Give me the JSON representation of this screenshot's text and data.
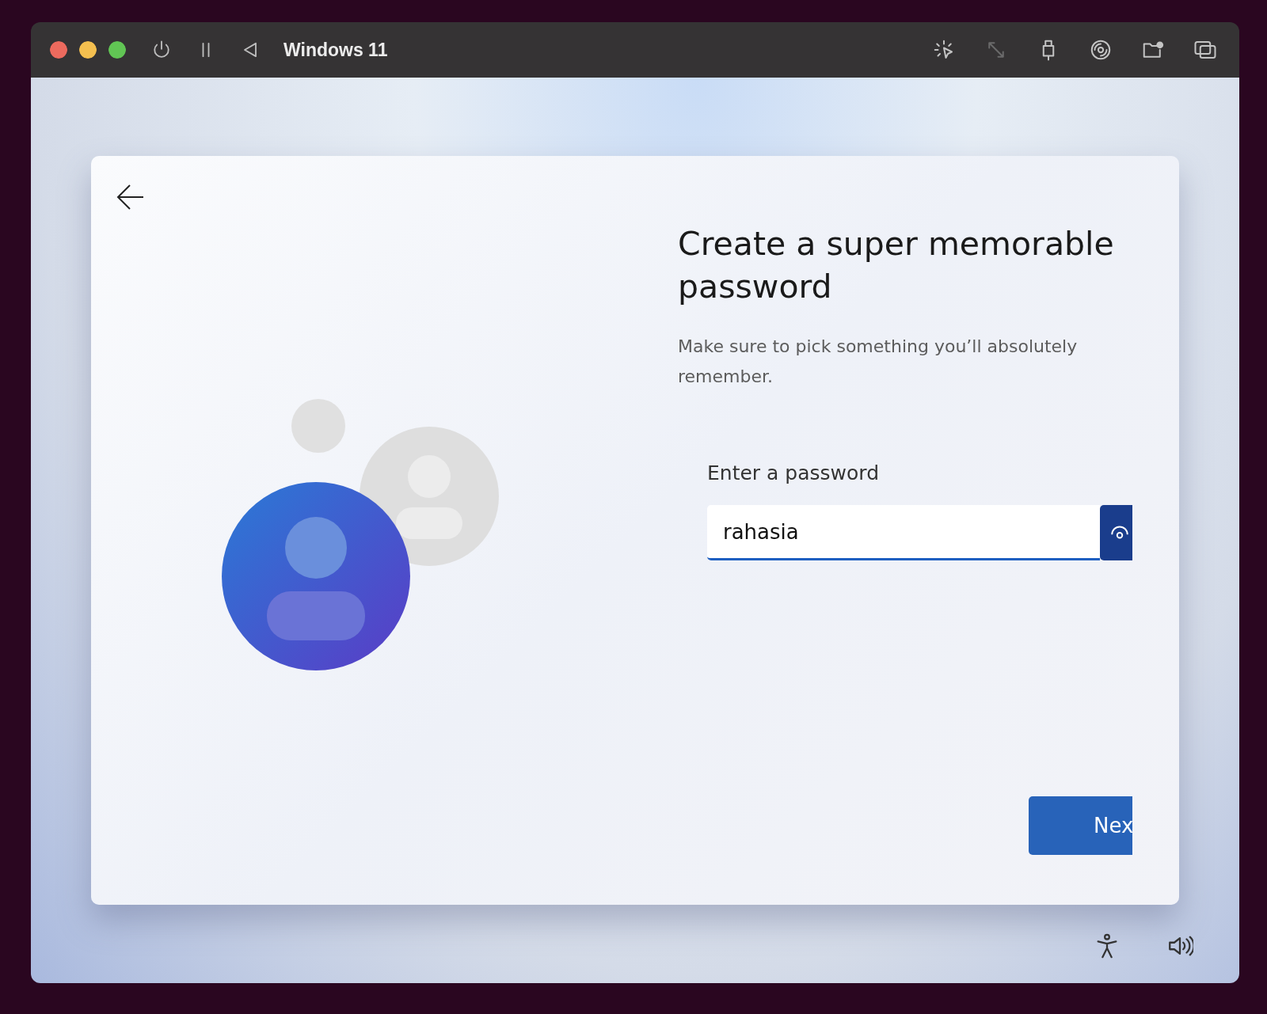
{
  "window": {
    "title": "Windows 11"
  },
  "toolbar_buttons": [
    {
      "kind": "cursor",
      "disabled": false
    },
    {
      "kind": "resize",
      "disabled": true
    },
    {
      "kind": "usb",
      "disabled": false
    },
    {
      "kind": "disc",
      "disabled": false
    },
    {
      "kind": "shared-folder",
      "disabled": false
    },
    {
      "kind": "windows",
      "disabled": false
    }
  ],
  "setup": {
    "heading": "Create a super memorable password",
    "description": "Make sure to pick something you’ll absolutely remember.",
    "password_field": {
      "label": "Enter a password",
      "value": "rahasia",
      "focused": true
    },
    "next_button": "Nex"
  },
  "tray_buttons": [
    {
      "kind": "accessibility"
    },
    {
      "kind": "volume"
    }
  ]
}
